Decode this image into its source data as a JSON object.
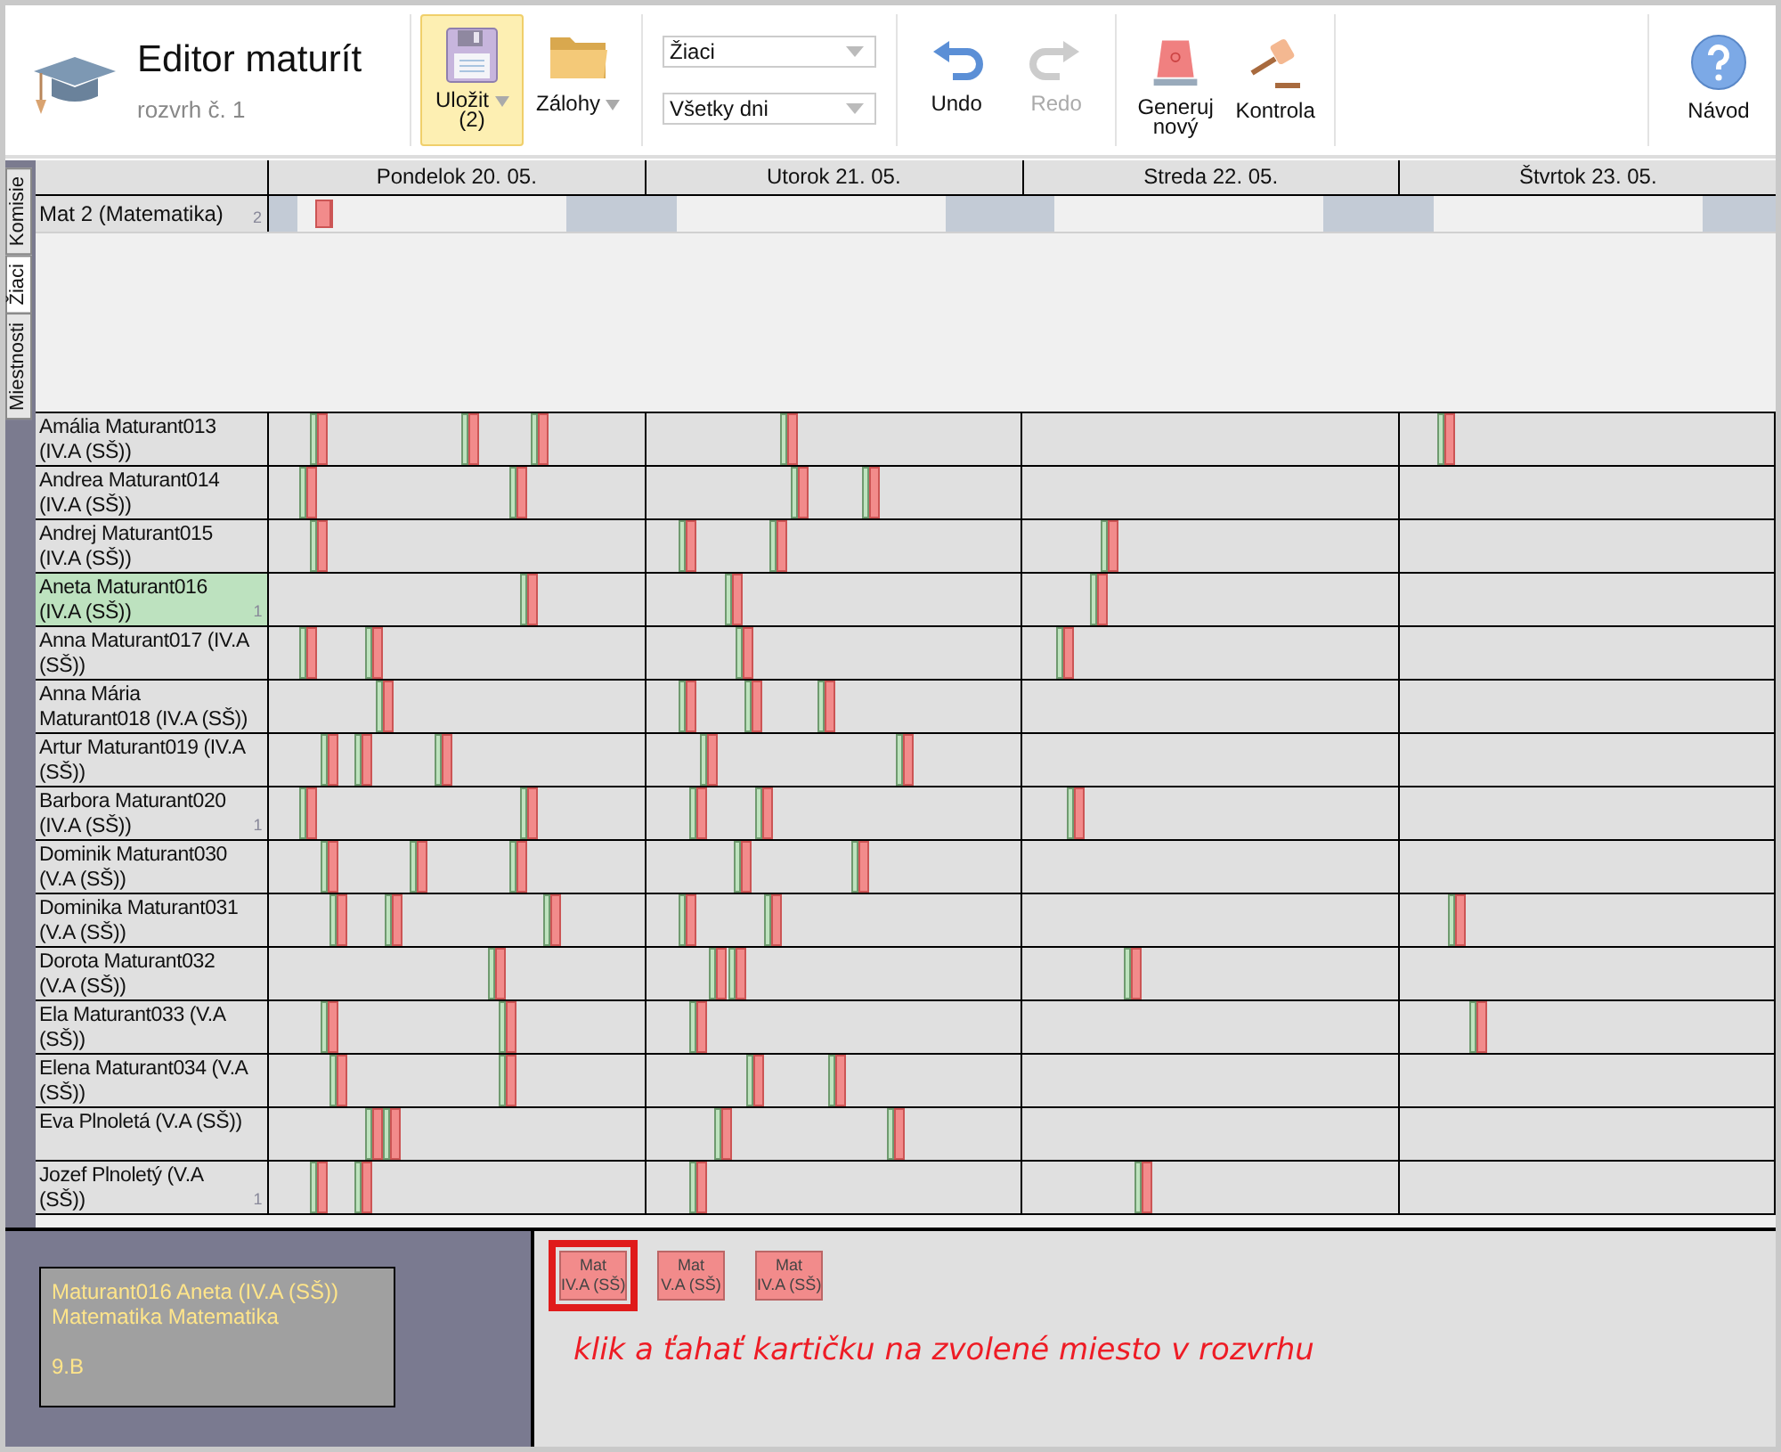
{
  "app": {
    "title": "Editor maturít",
    "subtitle": "rozvrh č. 1"
  },
  "toolbar": {
    "save": {
      "label": "Uložit",
      "count": "(2)",
      "highlighted": true
    },
    "backups": {
      "label": "Zálohy"
    },
    "filters": [
      {
        "value": "Žiaci"
      },
      {
        "value": "Všetky dni"
      }
    ],
    "buttons": [
      {
        "kind": "undo",
        "label": "Undo",
        "disabled": false
      },
      {
        "kind": "redo",
        "label": "Redo",
        "disabled": true
      },
      {
        "kind": "generate",
        "label": "Generuj nový",
        "disabled": false
      },
      {
        "kind": "check",
        "label": "Kontrola",
        "disabled": false
      },
      {
        "kind": "help",
        "label": "Návod",
        "disabled": false
      }
    ]
  },
  "side_tabs": [
    {
      "label": "Komisie",
      "selected": false
    },
    {
      "label": "Žiaci",
      "selected": true
    },
    {
      "label": "Miestnosti",
      "selected": false
    }
  ],
  "days": [
    "Pondelok 20. 05.",
    "Utorok 21. 05.",
    "Streda 22. 05.",
    "Štvrtok 23. 05."
  ],
  "exam": {
    "name": "Mat 2 (Matematika)",
    "count": "2"
  },
  "students": [
    {
      "name": "Amália Maturant013 (IV.A (SŠ))",
      "selected": false
    },
    {
      "name": "Andrea Maturant014 (IV.A (SŠ))",
      "selected": false
    },
    {
      "name": "Andrej Maturant015 (IV.A (SŠ))",
      "selected": false
    },
    {
      "name": "Aneta Maturant016 (IV.A (SŠ))",
      "selected": true,
      "count": "1"
    },
    {
      "name": "Anna Maturant017 (IV.A (SŠ))",
      "selected": false
    },
    {
      "name": "Anna Mária Maturant018 (IV.A (SŠ))",
      "selected": false
    },
    {
      "name": "Artur Maturant019 (IV.A (SŠ))",
      "selected": false
    },
    {
      "name": "Barbora Maturant020 (IV.A (SŠ))",
      "selected": false,
      "count": "1"
    },
    {
      "name": "Dominik Maturant030 (V.A (SŠ))",
      "selected": false
    },
    {
      "name": "Dominika Maturant031 (V.A (SŠ))",
      "selected": false
    },
    {
      "name": "Dorota Maturant032 (V.A (SŠ))",
      "selected": false
    },
    {
      "name": "Ela Maturant033 (V.A (SŠ))",
      "selected": false
    },
    {
      "name": "Elena Maturant034 (V.A (SŠ))",
      "selected": false
    },
    {
      "name": "Eva Plnoletá (V.A (SŠ))",
      "selected": false
    },
    {
      "name": "Jozef Plnoletý (V.A (SŠ))",
      "selected": false,
      "count": "1"
    }
  ],
  "detail": {
    "lines": [
      "Maturant016 Aneta (IV.A (SŠ))",
      "Matematika Matematika",
      "9.B"
    ]
  },
  "cards": [
    {
      "subject": "Mat",
      "class": "IV.A (SŠ)",
      "selected": true
    },
    {
      "subject": "Mat",
      "class": "V.A (SŠ)",
      "selected": false
    },
    {
      "subject": "Mat",
      "class": "IV.A (SŠ)",
      "selected": false
    }
  ],
  "hint": "klik a ťahať kartičku na zvolené miesto v rozvrhu"
}
